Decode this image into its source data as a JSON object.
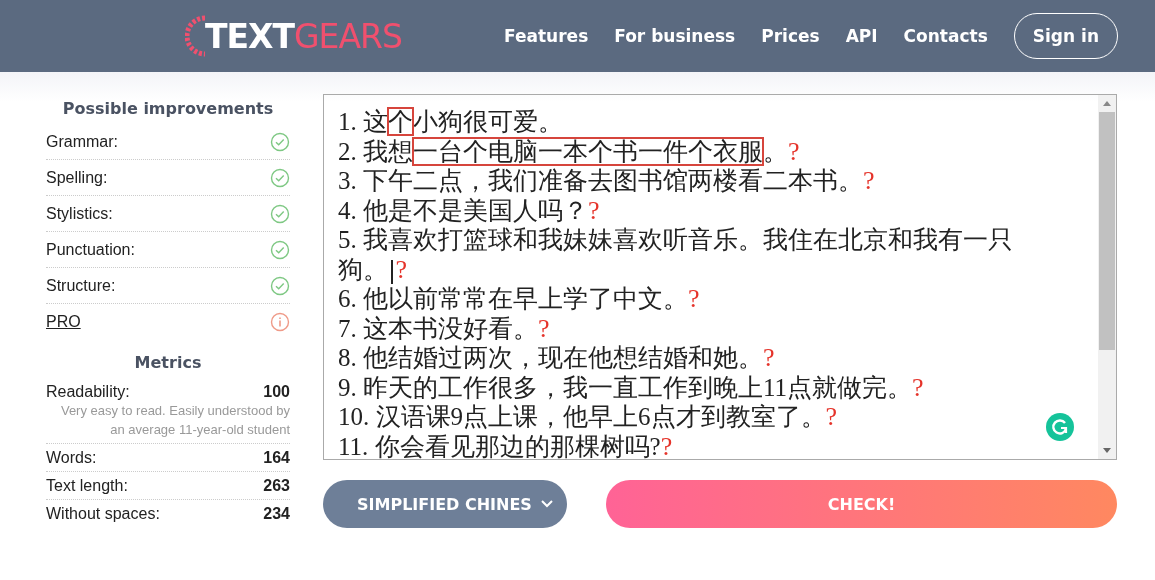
{
  "header": {
    "logo": {
      "first": "TEXT",
      "second": "GEARS"
    },
    "nav": [
      "Features",
      "For business",
      "Prices",
      "API",
      "Contacts"
    ],
    "sign_in": "Sign in"
  },
  "improvements": {
    "title": "Possible improvements",
    "items": [
      {
        "label": "Grammar:",
        "kind": "check"
      },
      {
        "label": "Spelling:",
        "kind": "check"
      },
      {
        "label": "Stylistics:",
        "kind": "check"
      },
      {
        "label": "Punctuation:",
        "kind": "check"
      },
      {
        "label": "Structure:",
        "kind": "check"
      },
      {
        "label": "PRO",
        "kind": "pro"
      }
    ]
  },
  "metrics": {
    "title": "Metrics",
    "items": [
      {
        "label": "Readability:",
        "value": "100",
        "note": "Very easy to read. Easily understood by an average 11-year-old student"
      },
      {
        "label": "Words:",
        "value": "164"
      },
      {
        "label": "Text length:",
        "value": "263"
      },
      {
        "label": "Without spaces:",
        "value": "234"
      }
    ]
  },
  "editor": {
    "lines": [
      {
        "segments": [
          {
            "text": "1. 这",
            "flagged": false
          },
          {
            "text": "个",
            "flagged": true
          },
          {
            "text": "小狗很可爱。",
            "flagged": false
          }
        ],
        "cursor": false
      },
      {
        "segments": [
          {
            "text": "2. 我想",
            "flagged": false
          },
          {
            "text": "一台个电脑一本个书一件个衣服",
            "flagged": true
          },
          {
            "text": "。",
            "flagged": false
          }
        ],
        "mark": "?",
        "cursor": false
      },
      {
        "segments": [
          {
            "text": "3. 下午二点，我们准备去图书馆两楼看二本书。",
            "flagged": false
          }
        ],
        "mark": "?",
        "cursor": false
      },
      {
        "segments": [
          {
            "text": "4. 他是不是美国人吗？",
            "flagged": false
          }
        ],
        "mark": "?",
        "cursor": false
      },
      {
        "segments": [
          {
            "text": "5. 我喜欢打篮球和我妹妹喜欢听音乐。我住在北京和我有一只狗。",
            "flagged": false
          }
        ],
        "mark": "?",
        "cursor": true
      },
      {
        "segments": [
          {
            "text": "6. 他以前常常在早上学了中文。",
            "flagged": false
          }
        ],
        "mark": "?",
        "cursor": false
      },
      {
        "segments": [
          {
            "text": "7. 这本书没好看。",
            "flagged": false
          }
        ],
        "mark": "?",
        "cursor": false
      },
      {
        "segments": [
          {
            "text": "8. 他结婚过两次，现在他想结婚和她。",
            "flagged": false
          }
        ],
        "mark": "?",
        "cursor": false
      },
      {
        "segments": [
          {
            "text": "9. 昨天的工作很多，我一直工作到晚上11点就做完。",
            "flagged": false
          }
        ],
        "mark": "?",
        "cursor": false
      },
      {
        "segments": [
          {
            "text": "10. 汉语课9点上课，他早上6点才到教室了。",
            "flagged": false
          }
        ],
        "mark": "?",
        "cursor": false
      },
      {
        "segments": [
          {
            "text": "11. 你会看见那边的那棵树吗?",
            "flagged": false
          }
        ],
        "mark": "?",
        "cursor": false
      }
    ]
  },
  "language_select": {
    "value": "SIMPLIFIED CHINES"
  },
  "check_button": "CHECK!"
}
